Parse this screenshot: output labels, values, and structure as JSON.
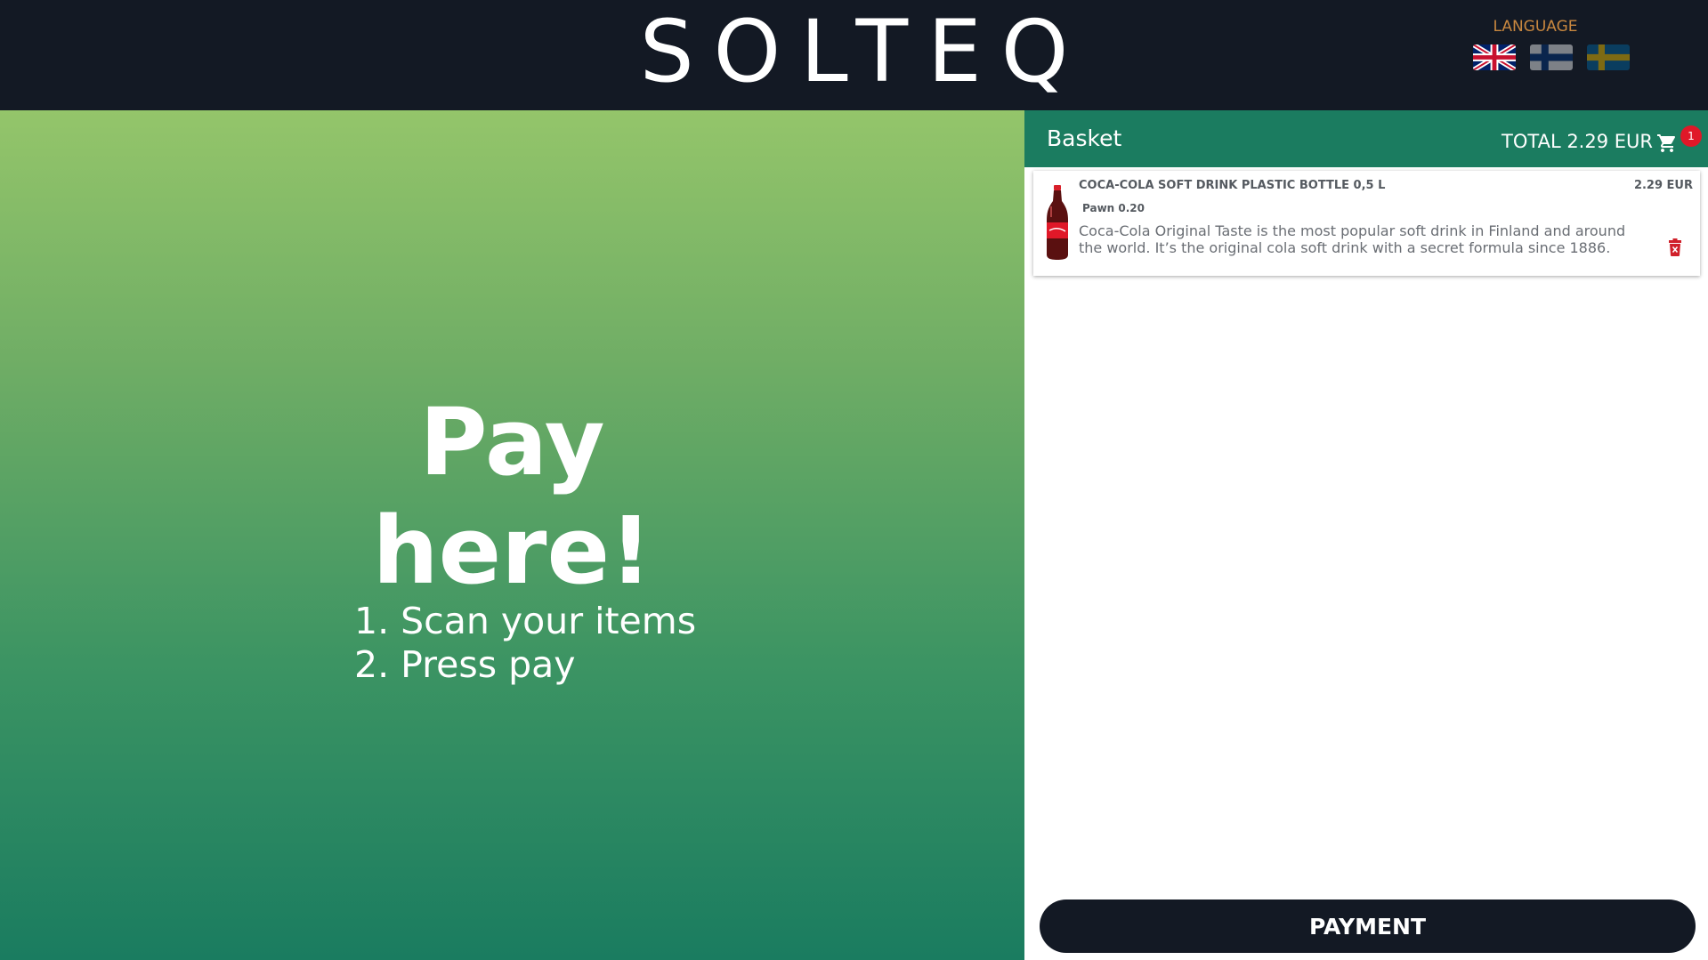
{
  "header": {
    "logo_text": "SOLTEQ",
    "language_label": "LANGUAGE",
    "languages": [
      {
        "code": "en",
        "icon": "uk-flag-icon",
        "active": true
      },
      {
        "code": "fi",
        "icon": "finland-flag-icon",
        "active": false
      },
      {
        "code": "sv",
        "icon": "sweden-flag-icon",
        "active": false
      }
    ]
  },
  "promo": {
    "title_line1": "Pay",
    "title_line2": "here!",
    "step1": "1. Scan your items",
    "step2": "2. Press pay"
  },
  "basket": {
    "title": "Basket",
    "total_label": "TOTAL 2.29 EUR",
    "cart_icon": "cart-icon",
    "item_count": "1",
    "items": [
      {
        "name": "COCA-COLA SOFT DRINK PLASTIC BOTTLE 0,5 L",
        "price": "2.29 EUR",
        "pawn": "Pawn 0.20",
        "description": "Coca-Cola Original Taste is the most popular soft drink in Finland and around the world. It’s the original cola soft drink with a secret formula since 1886. The",
        "image_icon": "coca-cola-bottle-icon",
        "delete_icon": "trash-icon"
      }
    ]
  },
  "payment_button_label": "PAYMENT",
  "colors": {
    "header_bg": "#131924",
    "basket_header_bg": "#1b7c60",
    "gradient_top": "#94c56a",
    "gradient_bottom": "#1a7c60",
    "language_label": "#c8873f",
    "badge": "#e01828",
    "delete": "#d0202a"
  }
}
